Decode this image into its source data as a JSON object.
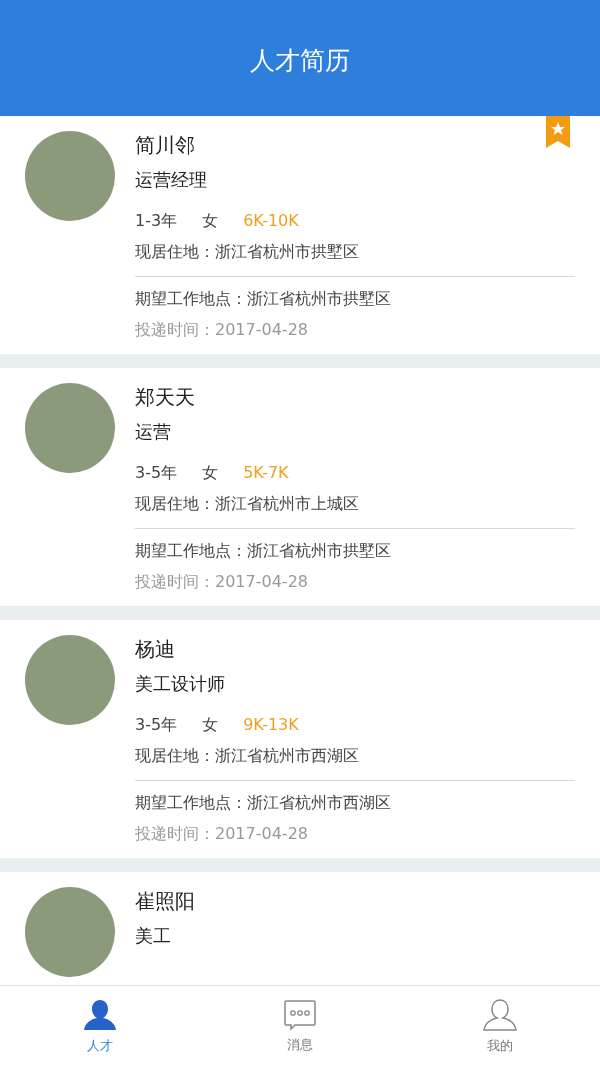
{
  "header": {
    "title": "人才简历"
  },
  "resumes": [
    {
      "name": "简川邻",
      "position": "运营经理",
      "experience": "1-3年",
      "gender": "女",
      "salary": "6K-10K",
      "residence": "现居住地：浙江省杭州市拱墅区",
      "expected_location": "期望工作地点：浙江省杭州市拱墅区",
      "submitted": "投递时间：2017-04-28",
      "starred": true
    },
    {
      "name": "郑天天",
      "position": "运营",
      "experience": "3-5年",
      "gender": "女",
      "salary": "5K-7K",
      "residence": "现居住地：浙江省杭州市上城区",
      "expected_location": "期望工作地点：浙江省杭州市拱墅区",
      "submitted": "投递时间：2017-04-28",
      "starred": false
    },
    {
      "name": "杨迪",
      "position": "美工设计师",
      "experience": "3-5年",
      "gender": "女",
      "salary": "9K-13K",
      "residence": "现居住地：浙江省杭州市西湖区",
      "expected_location": "期望工作地点：浙江省杭州市西湖区",
      "submitted": "投递时间：2017-04-28",
      "starred": false
    },
    {
      "name": "崔照阳",
      "position": "美工",
      "starred": false
    }
  ],
  "tabs": [
    {
      "label": "人才",
      "kind": "talent",
      "selected": true
    },
    {
      "label": "消息",
      "kind": "messages",
      "selected": false
    },
    {
      "label": "我的",
      "kind": "profile",
      "selected": false
    }
  ]
}
